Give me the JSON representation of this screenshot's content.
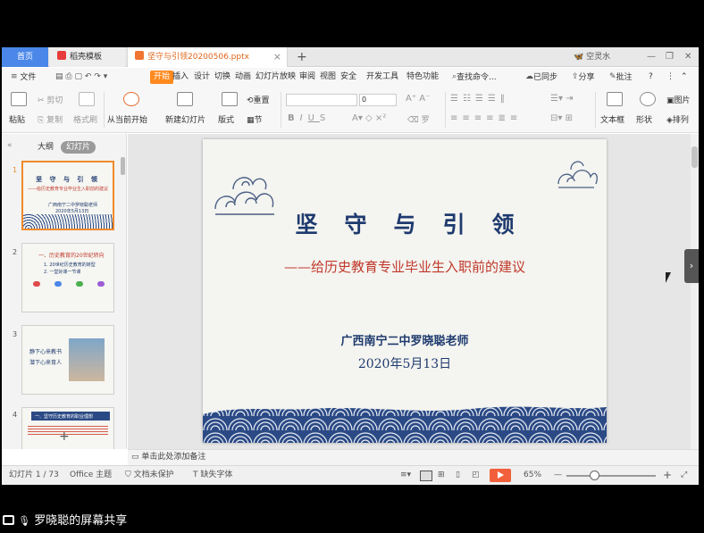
{
  "tabs": {
    "home": "首页",
    "templates": "稻壳模板",
    "document": "坚守与引领20200506.pptx",
    "close": "×",
    "new": "+"
  },
  "user": {
    "name": "空灵水"
  },
  "window": {
    "minimize": "—",
    "restore": "❐",
    "close": "✕"
  },
  "menu": {
    "file": "文件",
    "start": "开始",
    "items": [
      "插入",
      "设计",
      "切换",
      "动画",
      "幻灯片放映",
      "审阅",
      "视图",
      "安全",
      "开发工具",
      "特色功能"
    ],
    "search": "查找命令...",
    "sync": "已同步",
    "share": "分享",
    "comment": "批注",
    "help": "?"
  },
  "ribbon": {
    "paste": "粘贴",
    "cut": "剪切",
    "copy": "复制",
    "format_painter": "格式刷",
    "from_current": "从当前开始",
    "new_slide": "新建幻灯片",
    "layout": "版式",
    "reset": "重置",
    "section": "节",
    "font_size": "0",
    "textbox": "文本框",
    "shape": "形状",
    "picture": "图片",
    "arrange": "排列"
  },
  "left_pane": {
    "outline_tab": "大纲",
    "slides_tab": "幻灯片",
    "thumbs": [
      {
        "num": "1",
        "title": "坚 守 与 引 领",
        "line1": "——给历史教育专业毕业生入职前的建议",
        "line2": "广西南宁二中罗晓聪老师",
        "line3": "2020年5月13日"
      },
      {
        "num": "2",
        "title": "一、历史教育的20世纪转向",
        "line1": "1. 20世纪历史教育的转型",
        "line2": "2. 一堂好课一节课",
        "line3": ""
      },
      {
        "num": "3",
        "title": "",
        "line1": "静下心来教书",
        "line2": "潜下心来育人",
        "line3": ""
      },
      {
        "num": "4",
        "title": "一、坚守历史教育的职业理想",
        "line1": "",
        "line2": "",
        "line3": ""
      }
    ],
    "add": "+"
  },
  "slide": {
    "title": "坚守与引领",
    "subtitle": "——给历史教育专业毕业生入职前的建议",
    "author": "广西南宁二中罗晓聪老师",
    "date": "2020年5月13日"
  },
  "notes": {
    "placeholder": "单击此处添加备注"
  },
  "status": {
    "slide_counter": "幻灯片 1 / 73",
    "theme": "Office 主题",
    "protect": "文档未保护",
    "missing_font": "缺失字体",
    "zoom": "65%",
    "minus": "—",
    "plus": "+"
  },
  "share_bar": {
    "text": "罗晓聪的屏幕共享"
  },
  "colors": {
    "accent": "#4a87e8",
    "start_tab": "#ff8a1e",
    "slide_blue": "#1e3a6e",
    "slide_red": "#c0392b",
    "play": "#f2603b"
  }
}
